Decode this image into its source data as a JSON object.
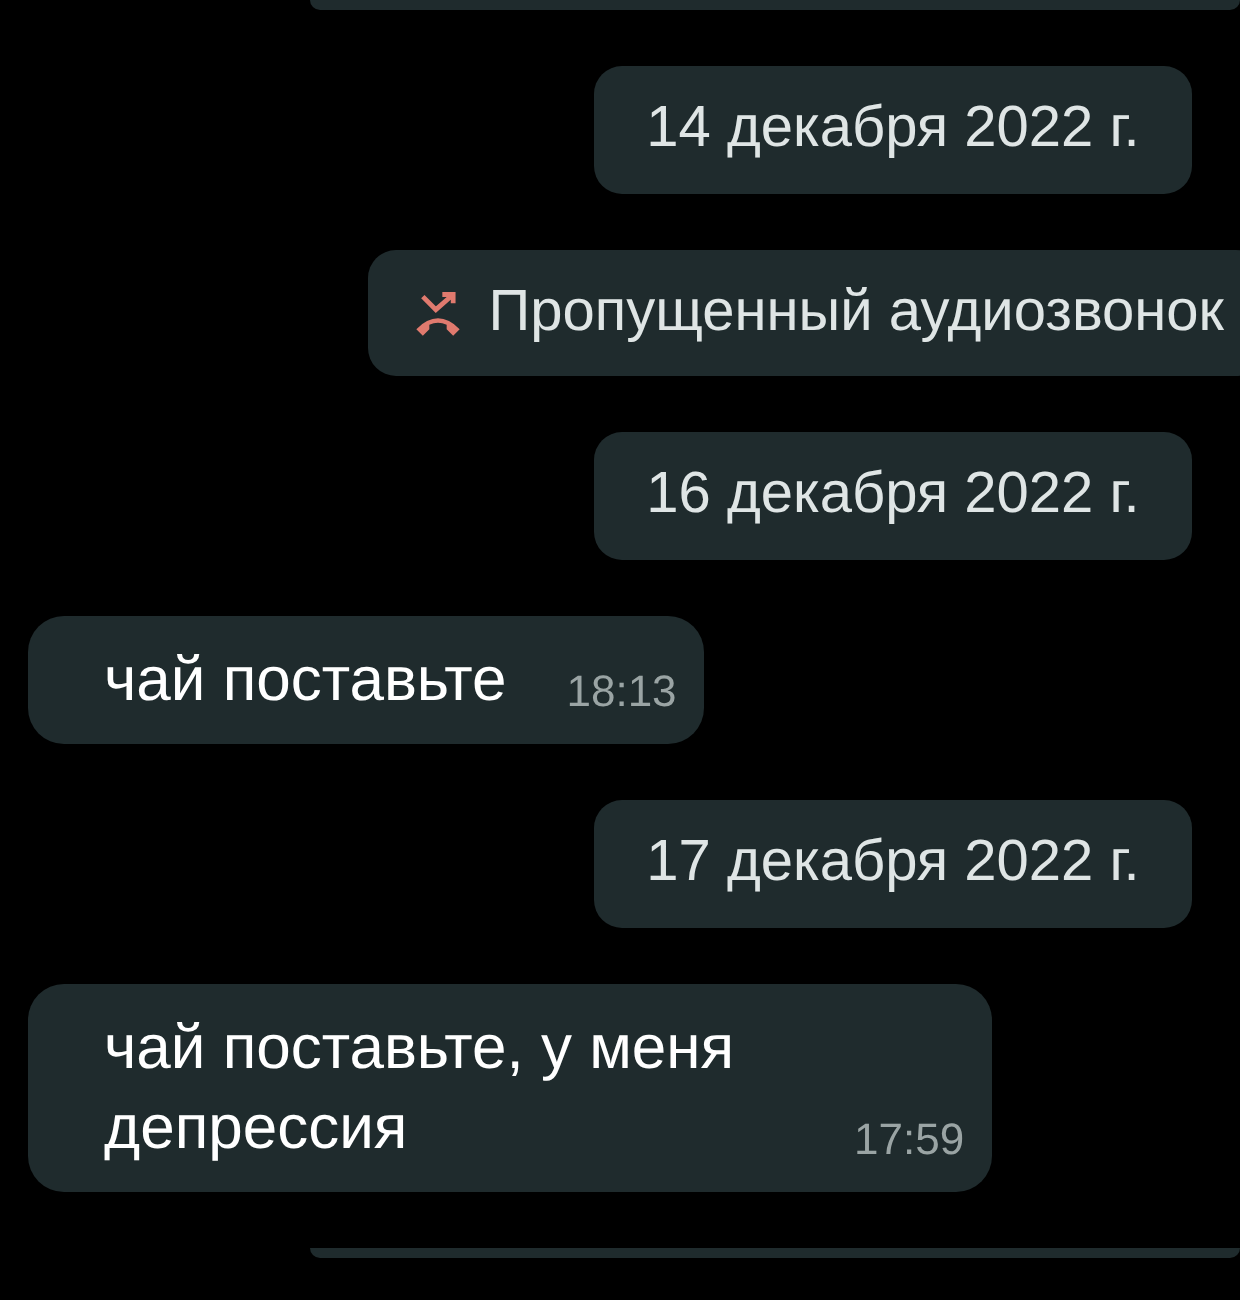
{
  "chat": [
    {
      "kind": "clipped_bubble"
    },
    {
      "kind": "date",
      "text": "14 декабря 2022 г."
    },
    {
      "kind": "missed_call",
      "text": "Пропущенный аудиозвонок"
    },
    {
      "kind": "date",
      "text": "16 декабря 2022 г."
    },
    {
      "kind": "message",
      "text": "чай поставьте",
      "time": "18:13"
    },
    {
      "kind": "date",
      "text": "17 декабря 2022 г."
    },
    {
      "kind": "message",
      "text": "чай поставьте, у меня депрессия",
      "time": "17:59"
    },
    {
      "kind": "clipped_bubble"
    }
  ]
}
